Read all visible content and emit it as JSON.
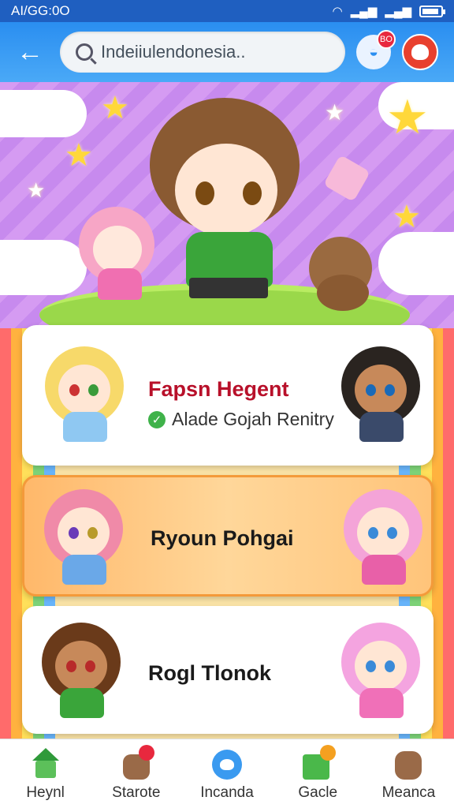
{
  "status_bar": {
    "time": "AI/GG:0O"
  },
  "header": {
    "search": {
      "value": "Indeiiulendonesia.."
    },
    "notification_badge": "BO"
  },
  "cards": [
    {
      "title": "Fapsn Hegent",
      "subtitle": "Alade Gojah Renitry",
      "verified": true
    },
    {
      "title": "Ryoun Pohgai"
    },
    {
      "title": "Rogl Tlonok"
    }
  ],
  "bottom_nav": [
    {
      "label": "Heynl",
      "icon": "house-icon"
    },
    {
      "label": "Starote",
      "icon": "mascot-icon"
    },
    {
      "label": "Incanda",
      "icon": "drop-icon"
    },
    {
      "label": "Gacle",
      "icon": "calendar-icon"
    },
    {
      "label": "Meanca",
      "icon": "bear-icon"
    }
  ],
  "colors": {
    "header": "#2a8ef0",
    "status_bar": "#1f5fc0",
    "card_title_first": "#b8102a",
    "verified": "#3fb24a"
  }
}
